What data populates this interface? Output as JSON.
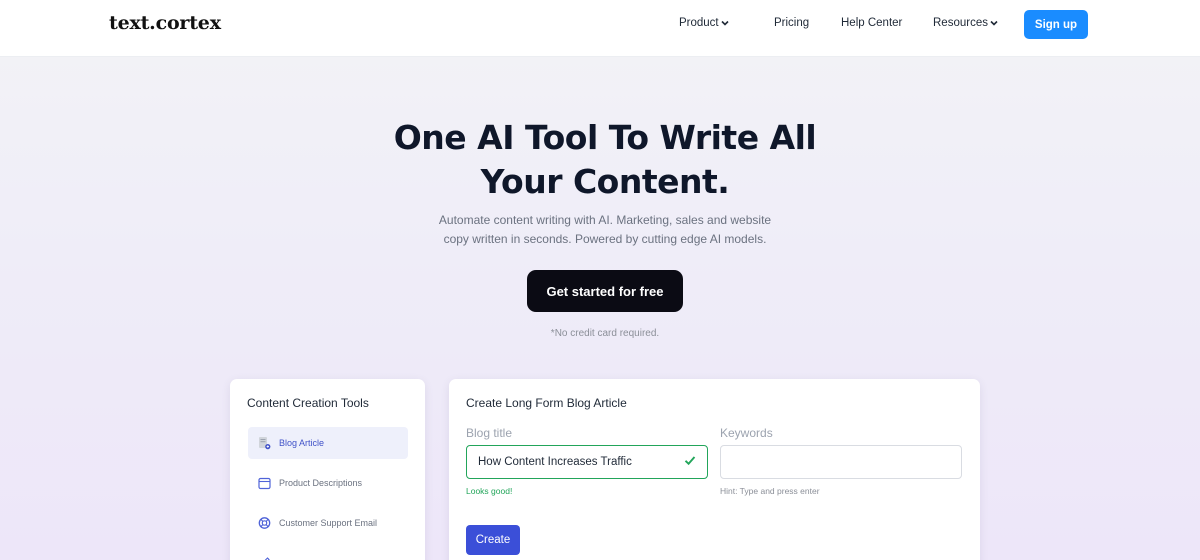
{
  "nav": {
    "logo": "text.cortex",
    "items": [
      {
        "label": "Product",
        "dropdown": true
      },
      {
        "label": "Pricing",
        "dropdown": false
      },
      {
        "label": "Help Center",
        "dropdown": false
      },
      {
        "label": "Resources",
        "dropdown": true
      }
    ],
    "signup_label": "Sign up"
  },
  "hero": {
    "title_line1": "One AI Tool To Write All",
    "title_line2": "Your Content.",
    "subtitle_line1": "Automate content writing with AI. Marketing, sales and website",
    "subtitle_line2": "copy written in seconds. Powered by cutting edge AI models.",
    "cta_label": "Get started for free",
    "note": "*No credit card required."
  },
  "tools": {
    "title": "Content Creation Tools",
    "items": [
      {
        "label": "Blog Article",
        "icon": "document-icon",
        "active": true
      },
      {
        "label": "Product Descriptions",
        "icon": "box-icon",
        "active": false
      },
      {
        "label": "Customer Support Email",
        "icon": "lifebuoy-icon",
        "active": false
      },
      {
        "label": "",
        "icon": "pen-icon",
        "active": false
      }
    ]
  },
  "form": {
    "title": "Create Long Form Blog Article",
    "blog_title_label": "Blog title",
    "blog_title_value": "How Content Increases Traffic",
    "blog_title_helper": "Looks good!",
    "keywords_label": "Keywords",
    "keywords_value": "",
    "keywords_helper": "Hint: Type and press enter",
    "create_label": "Create"
  },
  "colors": {
    "signup": "#1a8cff",
    "cta": "#0b0b14",
    "create": "#3b4fd8",
    "valid": "#22a55a",
    "active_tool": "#4052c8"
  }
}
